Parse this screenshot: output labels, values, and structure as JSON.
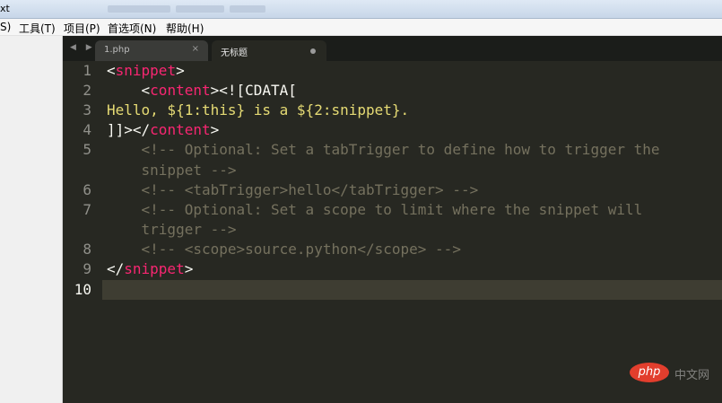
{
  "window": {
    "title_fragment": "xt"
  },
  "menubar": {
    "cut_item": "S)",
    "items": [
      {
        "label": "工具(T)"
      },
      {
        "label": "项目(P)"
      },
      {
        "label": "首选项(N)"
      },
      {
        "label": "帮助(H)"
      }
    ]
  },
  "tabs": {
    "nav_arrows": "◀ ▶",
    "items": [
      {
        "label": "1.php",
        "close": "×",
        "active": false
      },
      {
        "label": "无标题",
        "dirty": true,
        "active": true
      }
    ]
  },
  "editor": {
    "current_line": 10,
    "colors": {
      "background": "#272822",
      "tag": "#f92672",
      "string": "#e6db74",
      "comment": "#75715e",
      "text": "#f8f8f2",
      "gutter": "#90908a",
      "current_line": "#3e3d32"
    },
    "line_numbers": [
      "1",
      "2",
      "3",
      "4",
      "5",
      "6",
      "7",
      "8",
      "9",
      "10"
    ],
    "lines": {
      "l1_open": "<",
      "l1_tag": "snippet",
      "l1_close": ">",
      "l2_indent": "    <",
      "l2_tag": "content",
      "l2_rest": "><![CDATA[",
      "l3": "Hello, ${1:this} is a ${2:snippet}.",
      "l4_a": "]]></",
      "l4_tag": "content",
      "l4_b": ">",
      "l5a": "    <!-- Optional: Set a tabTrigger to define how to trigger the",
      "l5b": "    snippet -->",
      "l6": "    <!-- <tabTrigger>hello</tabTrigger> -->",
      "l7a": "    <!-- Optional: Set a scope to limit where the snippet will",
      "l7b": "    trigger -->",
      "l8": "    <!-- <scope>source.python</scope> -->",
      "l9_open": "</",
      "l9_tag": "snippet",
      "l9_close": ">"
    }
  },
  "watermark": {
    "logo": "php",
    "text": "中文网"
  }
}
